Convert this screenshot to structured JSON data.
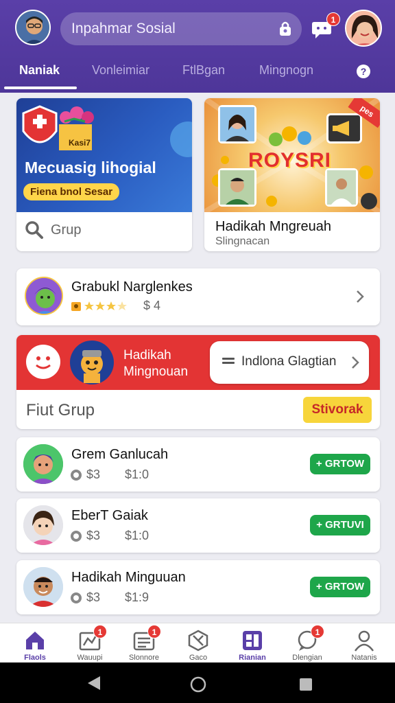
{
  "header": {
    "search_text": "Inpahmar Sosial",
    "chat_badge": "1",
    "tabs": [
      "Naniak",
      "Vonleimiar",
      "FtlBgan",
      "Mingnogn"
    ],
    "help_glyph": "?"
  },
  "promo_left": {
    "logo_text": "Kasi7",
    "title": "Mecuasig lihogial",
    "pill": "Fiena bnol Sesar",
    "grup_label": "Grup"
  },
  "promo_right": {
    "corner_tag": "pes",
    "banner_text": "ROYSRI",
    "title": "Hadikah Mngreuah",
    "subtitle": "Slingnacan"
  },
  "friend": {
    "name": "Grabukl Narglenkes",
    "rating": 3.5,
    "amount": "$ 4"
  },
  "reward": {
    "label_line1": "Hadikah",
    "label_line2": "Mingnouan",
    "pill_label": "Indlona Glagtian",
    "section_title": "Fiut Grup",
    "section_button": "Stivorak"
  },
  "list": [
    {
      "name": "Grem Ganlucah",
      "v1": "$3",
      "v2": "$1:0",
      "button": "+ GRTOW"
    },
    {
      "name": "EberT Gaiak",
      "v1": "$3",
      "v2": "$1:0",
      "button": "+ GRTUVI"
    },
    {
      "name": "Hadikah Minguuan",
      "v1": "$3",
      "v2": "$1:9",
      "button": "+ GRTOW"
    }
  ],
  "bottom_nav": [
    {
      "label": "Flaols",
      "icon": "home-icon",
      "badge": ""
    },
    {
      "label": "Wauupi",
      "icon": "chart-icon",
      "badge": "1"
    },
    {
      "label": "Slonnore",
      "icon": "list-icon",
      "badge": "1"
    },
    {
      "label": "Gaco",
      "icon": "hexagon-check-icon",
      "badge": ""
    },
    {
      "label": "Rianian",
      "icon": "grid-icon",
      "badge": ""
    },
    {
      "label": "Dlengian",
      "icon": "chat-icon",
      "badge": "1"
    },
    {
      "label": "Natanis",
      "icon": "person-icon",
      "badge": ""
    }
  ],
  "colors": {
    "header": "#4e3699",
    "accent_red": "#e33434",
    "accent_green": "#1ea64a",
    "accent_yellow": "#f7d53b"
  }
}
